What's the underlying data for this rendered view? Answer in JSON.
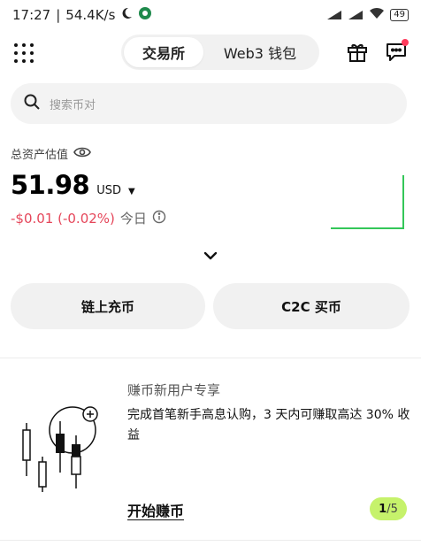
{
  "status_bar": {
    "time": "17:27",
    "net_speed": "54.4K/s",
    "battery": "49"
  },
  "header": {
    "tabs": [
      {
        "label": "交易所",
        "active": true
      },
      {
        "label": "Web3 钱包",
        "active": false
      }
    ]
  },
  "search": {
    "placeholder": "搜索币对"
  },
  "assets": {
    "label": "总资产估值",
    "amount": "51.98",
    "currency": "USD",
    "change": "-$0.01 (-0.02%)",
    "period": "今日"
  },
  "actions": {
    "deposit": "链上充币",
    "c2c": "C2C 买币"
  },
  "promo": {
    "title": "赚币新用户专享",
    "description": "完成首笔新手高息认购，3 天内可赚取高达 30% 收益",
    "cta": "开始赚币",
    "page_current": "1",
    "page_sep": "/",
    "page_total": "5"
  },
  "colors": {
    "negative": "#e5465a",
    "positive_line": "#34c759",
    "indicator_bg": "#c6f26b"
  }
}
